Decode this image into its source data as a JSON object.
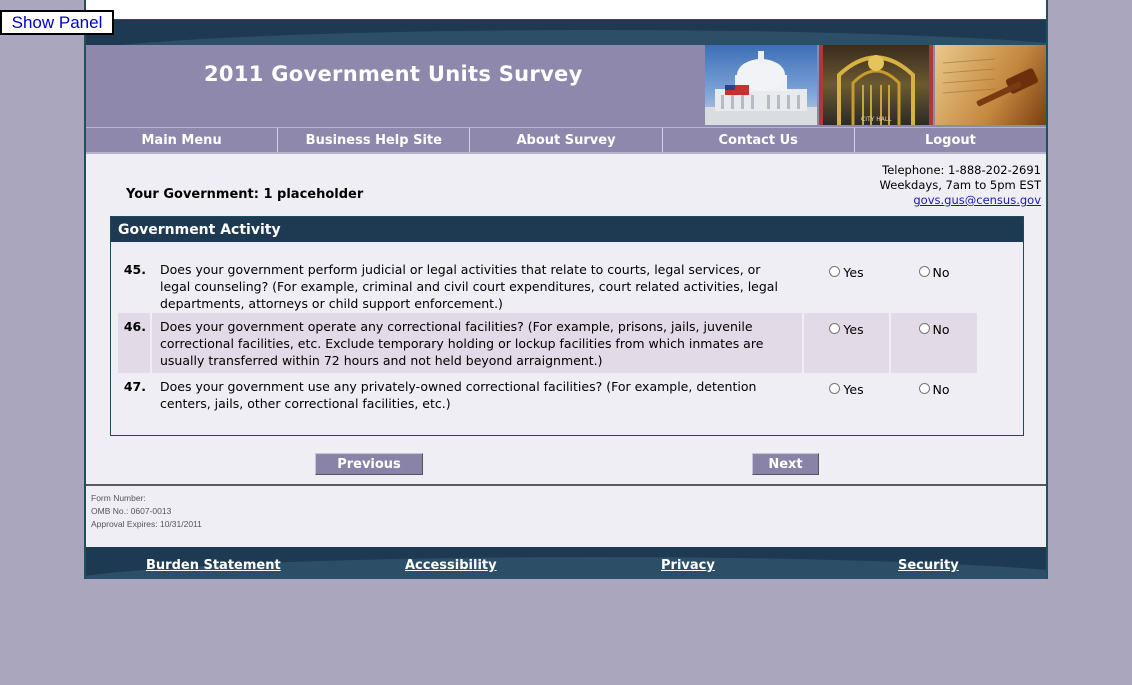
{
  "show_panel_label": "Show Panel",
  "banner": {
    "title": "2011 Government Units Survey"
  },
  "nav": [
    "Main Menu",
    "Business Help Site",
    "About Survey",
    "Contact Us",
    "Logout"
  ],
  "government_label": "Your Government: 1 placeholder",
  "contact": {
    "telephone": "Telephone: 1-888-202-2691",
    "hours": "Weekdays, 7am to 5pm EST",
    "email": "govs.gus@census.gov"
  },
  "section": {
    "title": "Government Activity",
    "questions": [
      {
        "number": "45.",
        "text": "Does your government perform judicial or legal activities that relate to courts, legal services, or legal counseling? (For example, criminal and civil court expenditures, court related activities, legal departments, attorneys or child support enforcement.)",
        "yes": "Yes",
        "no": "No"
      },
      {
        "number": "46.",
        "text": "Does your government operate any correctional facilities? (For example, prisons, jails, juvenile correctional facilities, etc. Exclude temporary holding or lockup facilities from which inmates are usually transferred within 72 hours and not held beyond arraignment.)",
        "yes": "Yes",
        "no": "No"
      },
      {
        "number": "47.",
        "text": "Does your government use any privately-owned correctional facilities? (For example, detention centers, jails, other correctional facilities, etc.)",
        "yes": "Yes",
        "no": "No"
      }
    ]
  },
  "buttons": {
    "previous": "Previous",
    "next": "Next"
  },
  "form_info": {
    "form_number": "Form Number:",
    "omb": "OMB No.: 0607-0013",
    "expires": "Approval Expires: 10/31/2011"
  },
  "footer": [
    "Burden Statement",
    "Accessibility",
    "Privacy",
    "Security"
  ],
  "photo_caption": "CITY HALL",
  "colors": {
    "banner": "#8f88ad",
    "header_dark": "#1e3a52",
    "row_shade": "#e2dae6",
    "button": "#8a83a8"
  }
}
